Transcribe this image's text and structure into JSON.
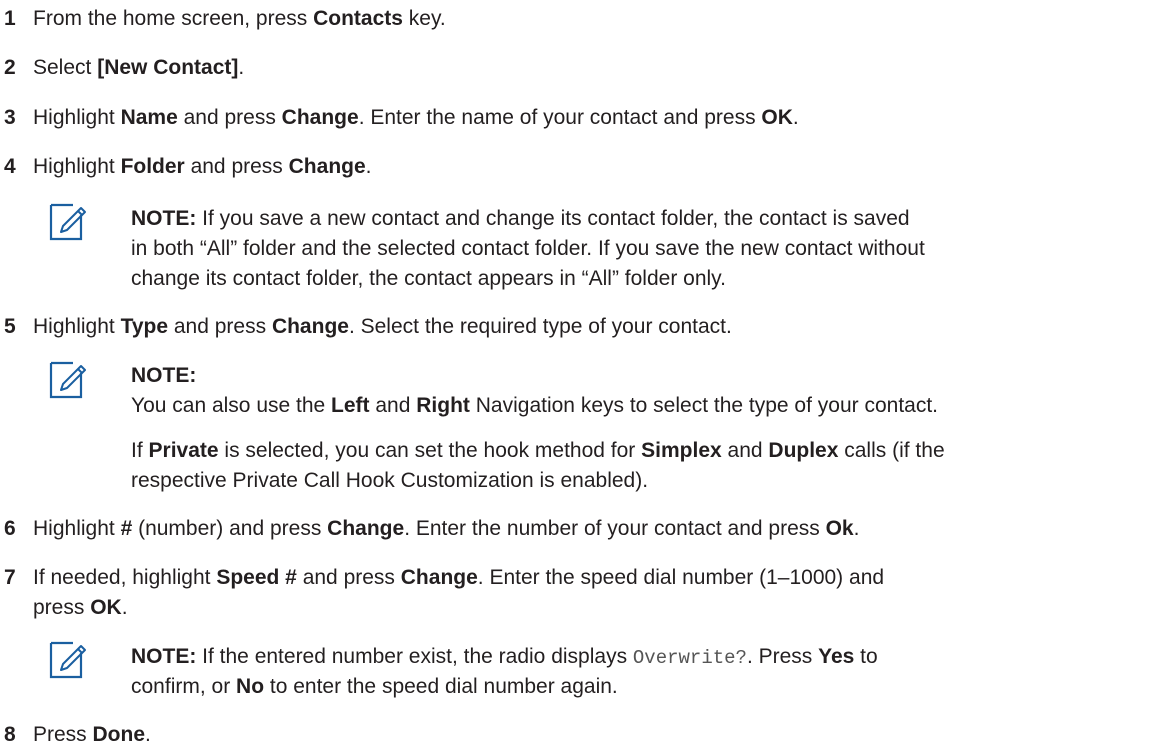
{
  "steps": [
    {
      "number": "1",
      "lines": [
        [
          "From the home screen, press ",
          "Contacts",
          " key."
        ]
      ]
    },
    {
      "number": "2",
      "lines": [
        [
          "Select ",
          "[New Contact]",
          "."
        ]
      ]
    },
    {
      "number": "3",
      "lines": [
        [
          "Highlight ",
          "Name",
          " and press ",
          "Change",
          ". Enter the name of your contact and press ",
          "OK",
          "."
        ]
      ]
    },
    {
      "number": "4",
      "lines": [
        [
          "Highlight ",
          "Folder",
          " and press ",
          "Change",
          "."
        ]
      ]
    },
    {
      "number": "5",
      "lines": [
        [
          "Highlight ",
          "Type",
          " and press ",
          "Change",
          ". Select the required type of your contact."
        ]
      ]
    },
    {
      "number": "6",
      "lines": [
        [
          "Highlight ",
          "#",
          " (number) and press ",
          "Change",
          ". Enter the number of your contact and press ",
          "Ok",
          "."
        ]
      ]
    },
    {
      "number": "7",
      "lines": [
        [
          "If needed, highlight ",
          "Speed #",
          " and press ",
          "Change",
          ". Enter the speed dial number (1–1000) and"
        ],
        [
          "press ",
          "OK",
          "."
        ]
      ]
    },
    {
      "number": "8",
      "lines": [
        [
          "Press ",
          "Done",
          "."
        ]
      ]
    }
  ],
  "notes": {
    "folder": {
      "lines": [
        [
          "",
          "NOTE:",
          " If you save a new contact and change its contact folder, the contact is saved"
        ],
        [
          "in both “All” folder and the selected contact folder. If you save the new contact without"
        ],
        [
          "change its contact folder, the contact appears in “All” folder only."
        ]
      ]
    },
    "type": {
      "lines": [
        [
          "",
          "NOTE:"
        ],
        [
          "You can also use the ",
          "Left",
          " and ",
          "Right",
          " Navigation keys to select the type of your contact."
        ],
        [
          "If ",
          "Private",
          " is selected, you can set the hook method for ",
          "Simplex",
          " and ",
          "Duplex",
          " calls (if the"
        ],
        [
          "respective Private Call Hook Customization is enabled)."
        ]
      ]
    },
    "speed": {
      "lines": [
        [
          "",
          "NOTE:",
          " If the entered number exist, the radio displays ",
          "Overwrite?",
          ". Press ",
          "Yes",
          " to"
        ],
        [
          "confirm, or ",
          "No",
          " to enter the speed dial number again."
        ]
      ]
    }
  },
  "icon": "note-pencil-icon"
}
